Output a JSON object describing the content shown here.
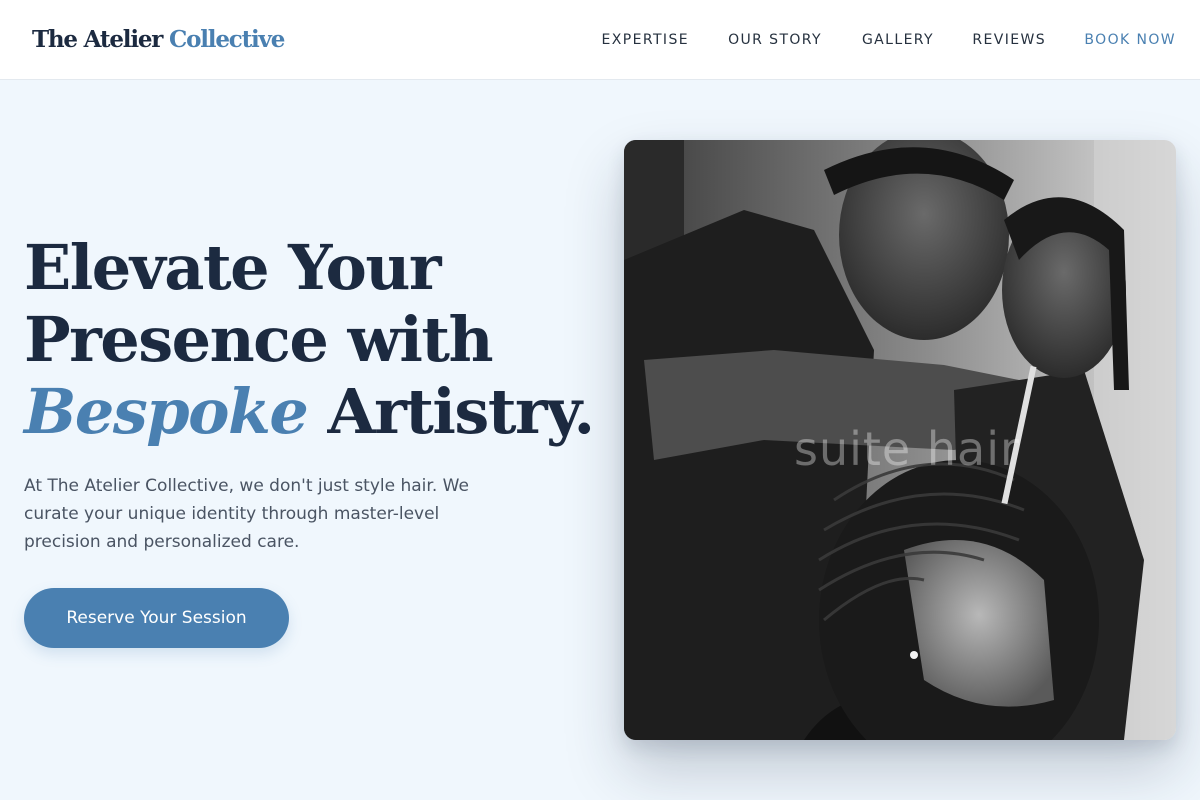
{
  "brand": {
    "name_primary": "The Atelier",
    "name_accent": "Collective"
  },
  "nav": {
    "items": [
      {
        "label": "EXPERTISE"
      },
      {
        "label": "OUR STORY"
      },
      {
        "label": "GALLERY"
      },
      {
        "label": "REVIEWS"
      },
      {
        "label": "BOOK NOW"
      }
    ]
  },
  "hero": {
    "title_line1": "Elevate Your",
    "title_line2": "Presence with",
    "title_accent": "Bespoke",
    "title_end": "Artistry.",
    "body": "At The Atelier Collective, we don't just style hair. We curate your unique identity through master-level precision and personalized care.",
    "cta_label": "Reserve Your Session",
    "image_watermark": "suite hair"
  },
  "colors": {
    "accent": "#4a80b1",
    "heading": "#1c2a40",
    "background": "#f0f7fd"
  }
}
